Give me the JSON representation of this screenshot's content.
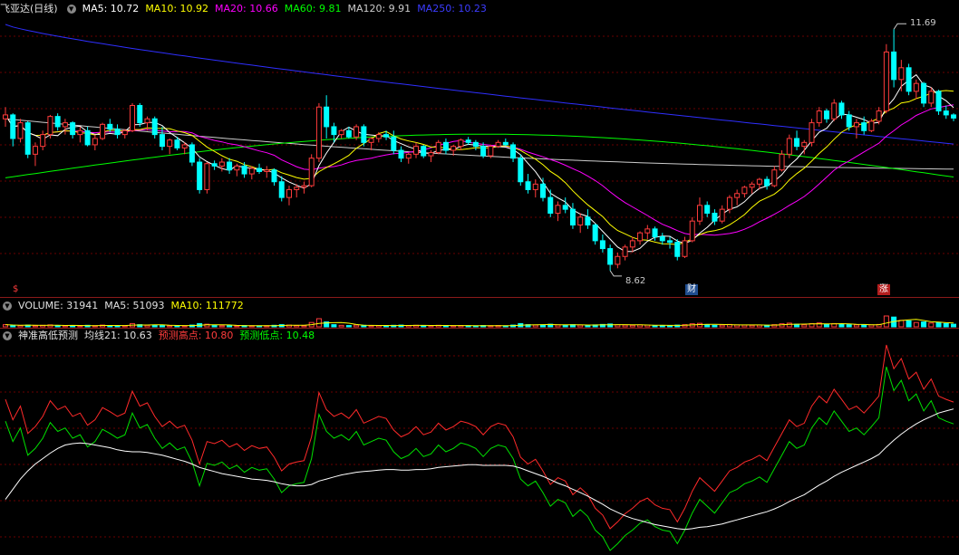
{
  "main_header": {
    "title": "飞亚达(日线)",
    "ma5": "MA5: 10.72",
    "ma10": "MA10: 10.92",
    "ma20": "MA20: 10.66",
    "ma60": "MA60: 9.81",
    "ma120": "MA120: 9.91",
    "ma250": "MA250: 10.23"
  },
  "price_annotations": {
    "high": "11.69",
    "low": "8.62"
  },
  "event_markers": {
    "left": "$",
    "mid": "财",
    "right": "涨"
  },
  "volume_header": {
    "title": "VOLUME: 31941",
    "ma5": "MA5: 51093",
    "ma10": "MA10: 111772"
  },
  "indicator_header": {
    "title": "神准高低预测",
    "avg21": "均线21: 10.63",
    "pred_high": "预测高点: 10.80",
    "pred_low": "预测低点: 10.48"
  },
  "colors": {
    "up": "#ff3c3c",
    "down": "#00ffff",
    "ma5": "#ffffff",
    "ma10": "#ffff00",
    "ma20": "#ff00ff",
    "ma60": "#00ff00",
    "ma120": "#cccccc",
    "ma250": "#2f2fff",
    "grid": "#6a0000",
    "divider": "#8b1a1a"
  },
  "chart_data": {
    "type": "line",
    "title": "飞亚达(日线)",
    "ylim": [
      8.4,
      11.9
    ],
    "candles": [
      [
        10.55,
        10.7,
        10.45,
        10.6
      ],
      [
        10.6,
        10.62,
        10.2,
        10.3
      ],
      [
        10.3,
        10.55,
        10.25,
        10.5
      ],
      [
        10.5,
        10.52,
        10.05,
        10.1
      ],
      [
        10.1,
        10.25,
        9.95,
        10.2
      ],
      [
        10.2,
        10.4,
        10.15,
        10.35
      ],
      [
        10.35,
        10.6,
        10.3,
        10.58
      ],
      [
        10.58,
        10.62,
        10.4,
        10.45
      ],
      [
        10.45,
        10.55,
        10.35,
        10.5
      ],
      [
        10.5,
        10.52,
        10.3,
        10.35
      ],
      [
        10.35,
        10.45,
        10.25,
        10.4
      ],
      [
        10.4,
        10.45,
        10.2,
        10.22
      ],
      [
        10.22,
        10.35,
        10.15,
        10.3
      ],
      [
        10.3,
        10.5,
        10.28,
        10.48
      ],
      [
        10.48,
        10.55,
        10.38,
        10.42
      ],
      [
        10.42,
        10.48,
        10.3,
        10.35
      ],
      [
        10.35,
        10.42,
        10.3,
        10.4
      ],
      [
        10.4,
        10.75,
        10.38,
        10.72
      ],
      [
        10.72,
        10.75,
        10.45,
        10.5
      ],
      [
        10.5,
        10.58,
        10.4,
        10.55
      ],
      [
        10.55,
        10.58,
        10.3,
        10.35
      ],
      [
        10.35,
        10.45,
        10.15,
        10.2
      ],
      [
        10.2,
        10.3,
        10.1,
        10.28
      ],
      [
        10.28,
        10.32,
        10.15,
        10.18
      ],
      [
        10.18,
        10.25,
        10.1,
        10.22
      ],
      [
        10.22,
        10.25,
        9.95,
        10.0
      ],
      [
        10.0,
        10.05,
        9.6,
        9.65
      ],
      [
        9.65,
        10.0,
        9.6,
        9.98
      ],
      [
        9.98,
        10.02,
        9.9,
        9.95
      ],
      [
        9.95,
        10.05,
        9.88,
        10.0
      ],
      [
        10.0,
        10.05,
        9.85,
        9.9
      ],
      [
        9.9,
        9.98,
        9.82,
        9.95
      ],
      [
        9.95,
        10.0,
        9.8,
        9.85
      ],
      [
        9.85,
        9.95,
        9.78,
        9.92
      ],
      [
        9.92,
        9.98,
        9.85,
        9.88
      ],
      [
        9.88,
        9.95,
        9.8,
        9.9
      ],
      [
        9.9,
        9.92,
        9.7,
        9.75
      ],
      [
        9.75,
        9.82,
        9.5,
        9.55
      ],
      [
        9.55,
        9.7,
        9.45,
        9.65
      ],
      [
        9.65,
        9.72,
        9.55,
        9.68
      ],
      [
        9.68,
        9.75,
        9.6,
        9.7
      ],
      [
        9.7,
        10.1,
        9.68,
        10.05
      ],
      [
        10.05,
        10.75,
        10.0,
        10.7
      ],
      [
        10.7,
        10.85,
        10.3,
        10.45
      ],
      [
        10.45,
        10.5,
        10.25,
        10.35
      ],
      [
        10.35,
        10.42,
        10.3,
        10.4
      ],
      [
        10.4,
        10.45,
        10.3,
        10.32
      ],
      [
        10.32,
        10.48,
        10.28,
        10.45
      ],
      [
        10.45,
        10.48,
        10.2,
        10.25
      ],
      [
        10.25,
        10.32,
        10.15,
        10.3
      ],
      [
        10.3,
        10.38,
        10.25,
        10.35
      ],
      [
        10.35,
        10.4,
        10.28,
        10.32
      ],
      [
        10.32,
        10.4,
        10.1,
        10.15
      ],
      [
        10.15,
        10.2,
        10.0,
        10.05
      ],
      [
        10.05,
        10.12,
        9.98,
        10.1
      ],
      [
        10.1,
        10.25,
        10.05,
        10.2
      ],
      [
        10.2,
        10.22,
        10.05,
        10.08
      ],
      [
        10.08,
        10.15,
        10.0,
        10.12
      ],
      [
        10.12,
        10.28,
        10.1,
        10.25
      ],
      [
        10.25,
        10.3,
        10.1,
        10.15
      ],
      [
        10.15,
        10.22,
        10.08,
        10.2
      ],
      [
        10.2,
        10.3,
        10.15,
        10.28
      ],
      [
        10.28,
        10.32,
        10.22,
        10.25
      ],
      [
        10.25,
        10.28,
        10.15,
        10.2
      ],
      [
        10.2,
        10.25,
        10.05,
        10.08
      ],
      [
        10.08,
        10.22,
        10.05,
        10.2
      ],
      [
        10.2,
        10.28,
        10.18,
        10.25
      ],
      [
        10.25,
        10.3,
        10.2,
        10.22
      ],
      [
        10.22,
        10.25,
        10.0,
        10.05
      ],
      [
        10.05,
        10.1,
        9.7,
        9.75
      ],
      [
        9.75,
        9.85,
        9.6,
        9.65
      ],
      [
        9.65,
        9.78,
        9.55,
        9.72
      ],
      [
        9.72,
        9.8,
        9.5,
        9.55
      ],
      [
        9.55,
        9.65,
        9.3,
        9.35
      ],
      [
        9.35,
        9.5,
        9.25,
        9.45
      ],
      [
        9.45,
        9.55,
        9.35,
        9.4
      ],
      [
        9.4,
        9.48,
        9.15,
        9.2
      ],
      [
        9.2,
        9.35,
        9.1,
        9.3
      ],
      [
        9.3,
        9.4,
        9.15,
        9.2
      ],
      [
        9.2,
        9.22,
        8.95,
        9.0
      ],
      [
        9.0,
        9.08,
        8.85,
        8.9
      ],
      [
        8.9,
        8.95,
        8.62,
        8.7
      ],
      [
        8.7,
        8.85,
        8.65,
        8.8
      ],
      [
        8.8,
        8.95,
        8.75,
        8.92
      ],
      [
        8.92,
        9.05,
        8.85,
        9.0
      ],
      [
        9.0,
        9.12,
        8.95,
        9.1
      ],
      [
        9.1,
        9.2,
        9.02,
        9.15
      ],
      [
        9.15,
        9.18,
        9.0,
        9.05
      ],
      [
        9.05,
        9.1,
        8.95,
        9.0
      ],
      [
        9.0,
        9.05,
        8.9,
        8.98
      ],
      [
        8.98,
        9.02,
        8.75,
        8.8
      ],
      [
        8.8,
        9.05,
        8.78,
        9.0
      ],
      [
        9.0,
        9.3,
        8.98,
        9.25
      ],
      [
        9.25,
        9.55,
        9.2,
        9.45
      ],
      [
        9.45,
        9.5,
        9.3,
        9.35
      ],
      [
        9.35,
        9.4,
        9.2,
        9.25
      ],
      [
        9.25,
        9.45,
        9.22,
        9.4
      ],
      [
        9.4,
        9.58,
        9.35,
        9.55
      ],
      [
        9.55,
        9.65,
        9.45,
        9.6
      ],
      [
        9.6,
        9.7,
        9.55,
        9.68
      ],
      [
        9.68,
        9.75,
        9.6,
        9.72
      ],
      [
        9.72,
        9.8,
        9.65,
        9.78
      ],
      [
        9.78,
        9.82,
        9.65,
        9.7
      ],
      [
        9.7,
        9.95,
        9.68,
        9.9
      ],
      [
        9.9,
        10.15,
        9.88,
        10.1
      ],
      [
        10.1,
        10.35,
        10.05,
        10.3
      ],
      [
        10.3,
        10.4,
        10.15,
        10.2
      ],
      [
        10.2,
        10.28,
        10.1,
        10.25
      ],
      [
        10.25,
        10.55,
        10.2,
        10.5
      ],
      [
        10.5,
        10.7,
        10.45,
        10.65
      ],
      [
        10.65,
        10.68,
        10.5,
        10.55
      ],
      [
        10.55,
        10.8,
        10.52,
        10.75
      ],
      [
        10.75,
        10.78,
        10.55,
        10.6
      ],
      [
        10.6,
        10.65,
        10.4,
        10.45
      ],
      [
        10.45,
        10.55,
        10.3,
        10.5
      ],
      [
        10.5,
        10.58,
        10.35,
        10.4
      ],
      [
        10.4,
        10.55,
        10.38,
        10.52
      ],
      [
        10.52,
        10.7,
        10.48,
        10.65
      ],
      [
        10.65,
        11.5,
        10.62,
        11.4
      ],
      [
        11.4,
        11.69,
        10.95,
        11.05
      ],
      [
        11.05,
        11.3,
        10.9,
        11.2
      ],
      [
        11.2,
        11.25,
        10.85,
        10.9
      ],
      [
        10.9,
        11.05,
        10.8,
        11.0
      ],
      [
        11.0,
        11.02,
        10.7,
        10.75
      ],
      [
        10.75,
        10.95,
        10.7,
        10.9
      ],
      [
        10.9,
        10.92,
        10.6,
        10.65
      ],
      [
        10.65,
        10.72,
        10.55,
        10.6
      ],
      [
        10.6,
        10.62,
        10.52,
        10.56
      ]
    ],
    "volume": [
      0.2,
      0.14,
      0.12,
      0.16,
      0.1,
      0.14,
      0.18,
      0.12,
      0.1,
      0.12,
      0.09,
      0.14,
      0.1,
      0.16,
      0.12,
      0.1,
      0.1,
      0.3,
      0.2,
      0.14,
      0.16,
      0.12,
      0.1,
      0.12,
      0.09,
      0.16,
      0.3,
      0.24,
      0.12,
      0.1,
      0.12,
      0.09,
      0.12,
      0.1,
      0.09,
      0.1,
      0.14,
      0.2,
      0.16,
      0.12,
      0.1,
      0.4,
      0.75,
      0.45,
      0.2,
      0.14,
      0.12,
      0.16,
      0.14,
      0.1,
      0.12,
      0.1,
      0.14,
      0.16,
      0.12,
      0.14,
      0.12,
      0.1,
      0.14,
      0.12,
      0.1,
      0.12,
      0.1,
      0.09,
      0.12,
      0.1,
      0.12,
      0.09,
      0.16,
      0.3,
      0.2,
      0.16,
      0.18,
      0.24,
      0.18,
      0.14,
      0.2,
      0.16,
      0.14,
      0.18,
      0.22,
      0.26,
      0.18,
      0.16,
      0.14,
      0.18,
      0.16,
      0.12,
      0.12,
      0.1,
      0.16,
      0.2,
      0.28,
      0.32,
      0.18,
      0.14,
      0.16,
      0.22,
      0.18,
      0.16,
      0.14,
      0.16,
      0.14,
      0.2,
      0.28,
      0.34,
      0.24,
      0.18,
      0.3,
      0.36,
      0.24,
      0.3,
      0.24,
      0.2,
      0.18,
      0.16,
      0.18,
      0.22,
      1.0,
      0.9,
      0.6,
      0.55,
      0.4,
      0.45,
      0.35,
      0.4,
      0.3,
      0.24
    ],
    "avg21": [
      9.3,
      9.45,
      9.6,
      9.72,
      9.82,
      9.9,
      9.98,
      10.05,
      10.1,
      10.12,
      10.13,
      10.12,
      10.1,
      10.08,
      10.06,
      10.03,
      10.01,
      10.0,
      10.0,
      9.99,
      9.97,
      9.95,
      9.92,
      9.89,
      9.86,
      9.82,
      9.77,
      9.74,
      9.71,
      9.68,
      9.66,
      9.64,
      9.62,
      9.6,
      9.59,
      9.58,
      9.56,
      9.53,
      9.51,
      9.5,
      9.5,
      9.52,
      9.57,
      9.6,
      9.63,
      9.66,
      9.68,
      9.7,
      9.71,
      9.72,
      9.73,
      9.74,
      9.74,
      9.73,
      9.73,
      9.74,
      9.74,
      9.75,
      9.77,
      9.78,
      9.79,
      9.8,
      9.81,
      9.81,
      9.8,
      9.8,
      9.8,
      9.8,
      9.79,
      9.76,
      9.72,
      9.68,
      9.64,
      9.59,
      9.54,
      9.5,
      9.45,
      9.4,
      9.35,
      9.29,
      9.23,
      9.16,
      9.11,
      9.06,
      9.02,
      8.99,
      8.96,
      8.93,
      8.91,
      8.89,
      8.87,
      8.86,
      8.87,
      8.89,
      8.9,
      8.92,
      8.94,
      8.97,
      9.0,
      9.03,
      9.06,
      9.09,
      9.12,
      9.16,
      9.21,
      9.27,
      9.32,
      9.37,
      9.44,
      9.51,
      9.57,
      9.64,
      9.7,
      9.75,
      9.8,
      9.85,
      9.9,
      9.96,
      10.07,
      10.17,
      10.26,
      10.34,
      10.41,
      10.47,
      10.52,
      10.57,
      10.6,
      10.63
    ],
    "pred_high_series_offset": 0.17,
    "pred_low_series_offset": -0.15
  }
}
